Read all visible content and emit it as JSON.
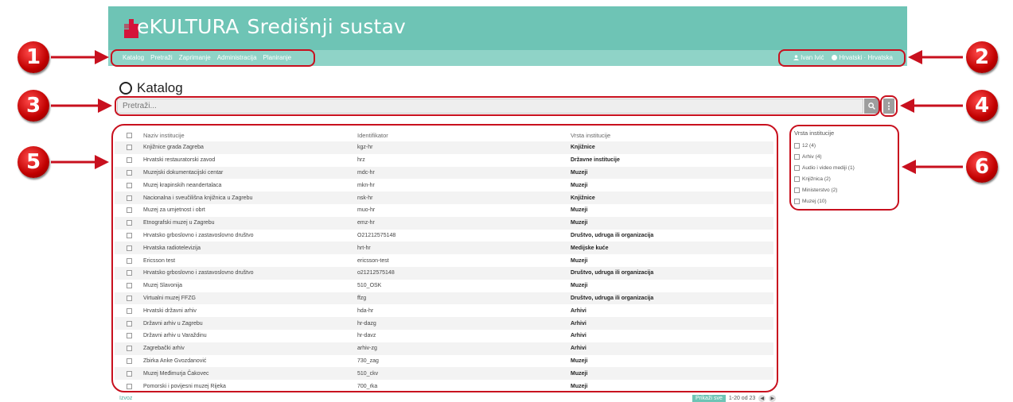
{
  "header": {
    "logo_e": "e",
    "logo_kultura": "KULTURA",
    "title": "Središnji sustav",
    "nav": [
      "Katalog",
      "Pretraži",
      "Zaprimanje",
      "Administracija",
      "Planiranje"
    ],
    "user": "Ivan Ivić",
    "language": "Hrvatski · Hrvatska"
  },
  "catalog": {
    "title": "Katalog",
    "search_placeholder": "Pretraži..."
  },
  "table": {
    "columns": [
      "Naziv institucije",
      "Identifikator",
      "Vrsta institucije"
    ],
    "rows": [
      [
        "Knjižnice grada Zagreba",
        "kgz-hr",
        "Knjižnice"
      ],
      [
        "Hrvatski restauratorski zavod",
        "hrz",
        "Državne institucije"
      ],
      [
        "Muzejski dokumentacijski centar",
        "mdc-hr",
        "Muzeji"
      ],
      [
        "Muzej krapinskih neandertalaca",
        "mkn-hr",
        "Muzeji"
      ],
      [
        "Nacionalna i sveučilišna knjižnica u Zagrebu",
        "nsk-hr",
        "Knjižnice"
      ],
      [
        "Muzej za umjetnost i obrt",
        "muo-hr",
        "Muzeji"
      ],
      [
        "Etnografski muzej u Zagrebu",
        "emz-hr",
        "Muzeji"
      ],
      [
        "Hrvatsko grboslovno i zastavoslovno društvo",
        "O21212575148",
        "Društvo, udruga ili organizacija"
      ],
      [
        "Hrvatska radiotelevizija",
        "hrt-hr",
        "Medijske kuće"
      ],
      [
        "Ericsson test",
        "ericsson-test",
        "Muzeji"
      ],
      [
        "Hrvatsko grboslovno i zastavoslovno društvo",
        "o21212575148",
        "Društvo, udruga ili organizacija"
      ],
      [
        "Muzej Slavonija",
        "510_OSK",
        "Muzeji"
      ],
      [
        "Virtualni muzej FFZG",
        "ffzg",
        "Društvo, udruga ili organizacija"
      ],
      [
        "Hrvatski državni arhiv",
        "hda-hr",
        "Arhivi"
      ],
      [
        "Državni arhiv u Zagrebu",
        "hr-dazg",
        "Arhivi"
      ],
      [
        "Državni arhiv u Varaždinu",
        "hr-davz",
        "Arhivi"
      ],
      [
        "Zagrebački arhiv",
        "arhiv-zg",
        "Arhivi"
      ],
      [
        "Zbirka Anke Gvozdanović",
        "730_zag",
        "Muzeji"
      ],
      [
        "Muzej Međimurja Čakovec",
        "510_ckv",
        "Muzeji"
      ],
      [
        "Pomorski i povijesni muzej Rijeka",
        "700_rka",
        "Muzeji"
      ]
    ]
  },
  "footer": {
    "export": "Izvoz",
    "show_all": "Prikaži sve",
    "range": "1-20 od 23"
  },
  "facets": {
    "title": "Vrsta institucije",
    "items": [
      "12 (4)",
      "Arhiv (4)",
      "Audio i video mediji (1)",
      "Knjižnica (2)",
      "Ministerstvo (2)",
      "Muzej (10)"
    ]
  },
  "badges": [
    "1",
    "2",
    "3",
    "4",
    "5",
    "6"
  ],
  "colors": {
    "header": "#6ec4b5",
    "nav": "#8fd3c7",
    "logo": "#d4143a",
    "annotation": "#c8101e"
  }
}
